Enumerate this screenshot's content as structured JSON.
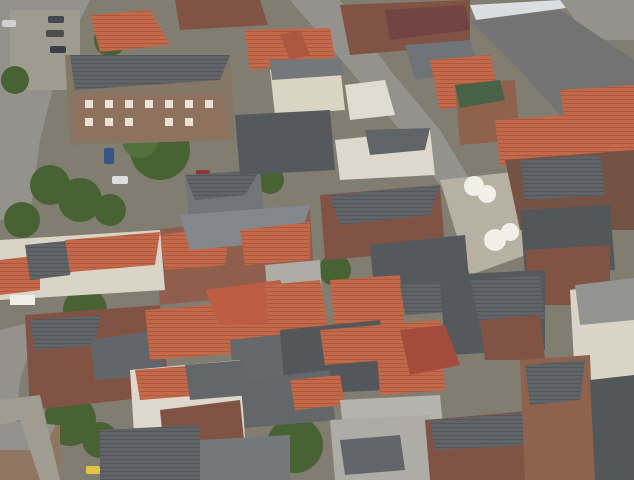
{
  "scene": {
    "subject": "aerial-view-town-centre",
    "palette": {
      "asphalt": "#8d8b84",
      "square_paving": "#b9b2a3",
      "roof_red": "#b8553b",
      "roof_orange": "#c9683f",
      "roof_slate": "#55595c",
      "roof_dark": "#3e4245",
      "brick": "#7a4a3a",
      "tree": "#3f5a2a",
      "flat_roof": "#a9a8a3"
    }
  }
}
